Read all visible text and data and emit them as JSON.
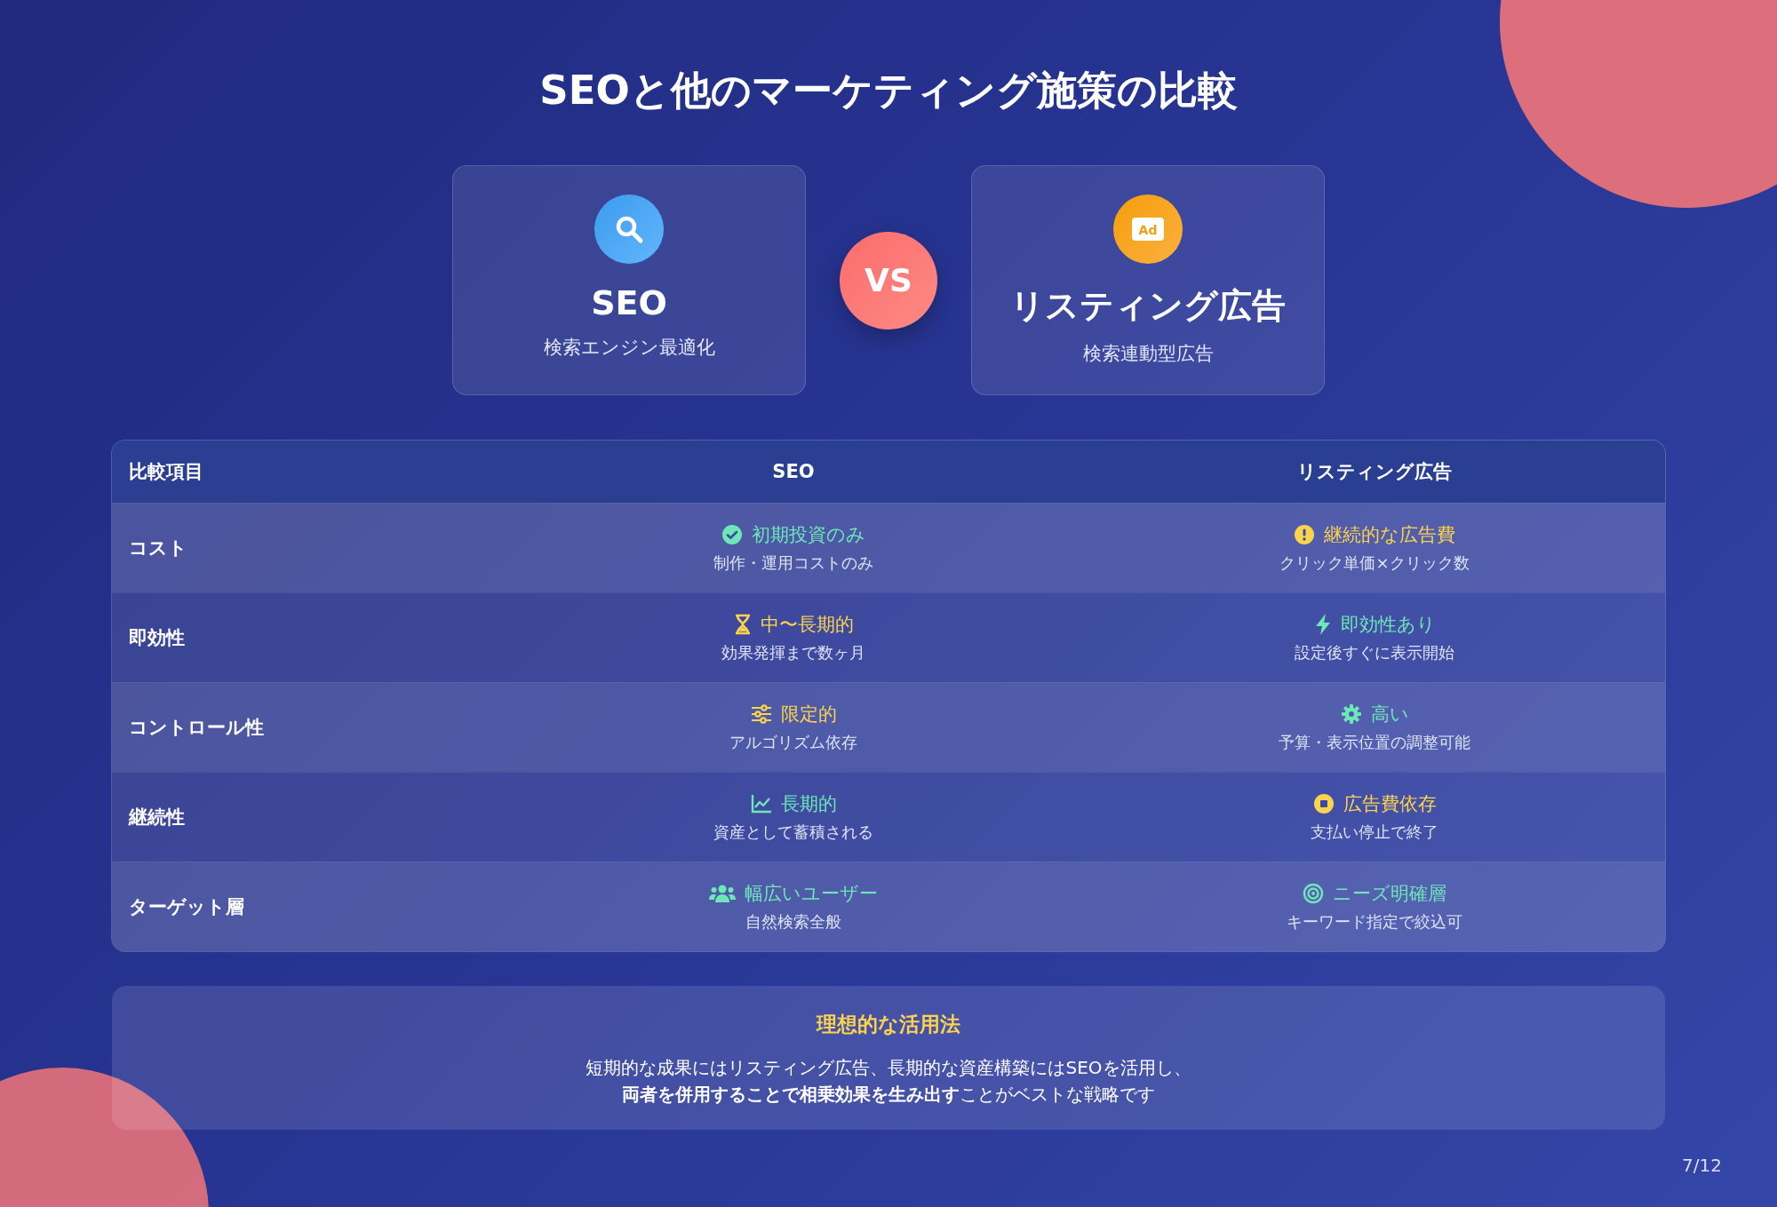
{
  "title": "SEOと他のマーケティング施策の比較",
  "cards": [
    {
      "kind": "search",
      "name": "SEO",
      "subtitle": "検索エンジン最適化"
    },
    {
      "kind": "ad",
      "badge_text": "Ad",
      "name": "リスティング広告",
      "subtitle": "検索連動型広告"
    }
  ],
  "vs": "VS",
  "table": {
    "columns": [
      "比較項目",
      "SEO",
      "リスティング広告"
    ],
    "rows": [
      {
        "label": "コスト",
        "seo": {
          "kind": "check",
          "color": "#6ee7b7",
          "value": "初期投資のみ",
          "note": "制作・運用コストのみ"
        },
        "listing": {
          "kind": "alert",
          "color": "#fcd34d",
          "value": "継続的な広告費",
          "note": "クリック単価×クリック数"
        }
      },
      {
        "label": "即効性",
        "seo": {
          "kind": "hourglass",
          "color": "#fcd34d",
          "value": "中〜長期的",
          "note": "効果発揮まで数ヶ月"
        },
        "listing": {
          "kind": "bolt",
          "color": "#6ee7b7",
          "value": "即効性あり",
          "note": "設定後すぐに表示開始"
        }
      },
      {
        "label": "コントロール性",
        "seo": {
          "kind": "sliders",
          "color": "#fcd34d",
          "value": "限定的",
          "note": "アルゴリズム依存"
        },
        "listing": {
          "kind": "gear",
          "color": "#6ee7b7",
          "value": "高い",
          "note": "予算・表示位置の調整可能"
        }
      },
      {
        "label": "継続性",
        "seo": {
          "kind": "chart",
          "color": "#6ee7b7",
          "value": "長期的",
          "note": "資産として蓄積される"
        },
        "listing": {
          "kind": "stop",
          "color": "#fcd34d",
          "value": "広告費依存",
          "note": "支払い停止で終了"
        }
      },
      {
        "label": "ターゲット層",
        "seo": {
          "kind": "users",
          "color": "#6ee7b7",
          "value": "幅広いユーザー",
          "note": "自然検索全般"
        },
        "listing": {
          "kind": "target",
          "color": "#6ee7b7",
          "value": "ニーズ明確層",
          "note": "キーワード指定で絞込可"
        }
      }
    ]
  },
  "summary": {
    "heading": "理想的な活用法",
    "lines": [
      "短期的な成果にはリスティング広告、長期的な資産構築にはSEOを活用し、",
      "**両者を併用することで相乗効果を生み出す**ことがベストな戦略です"
    ]
  },
  "page_number": "7/12"
}
